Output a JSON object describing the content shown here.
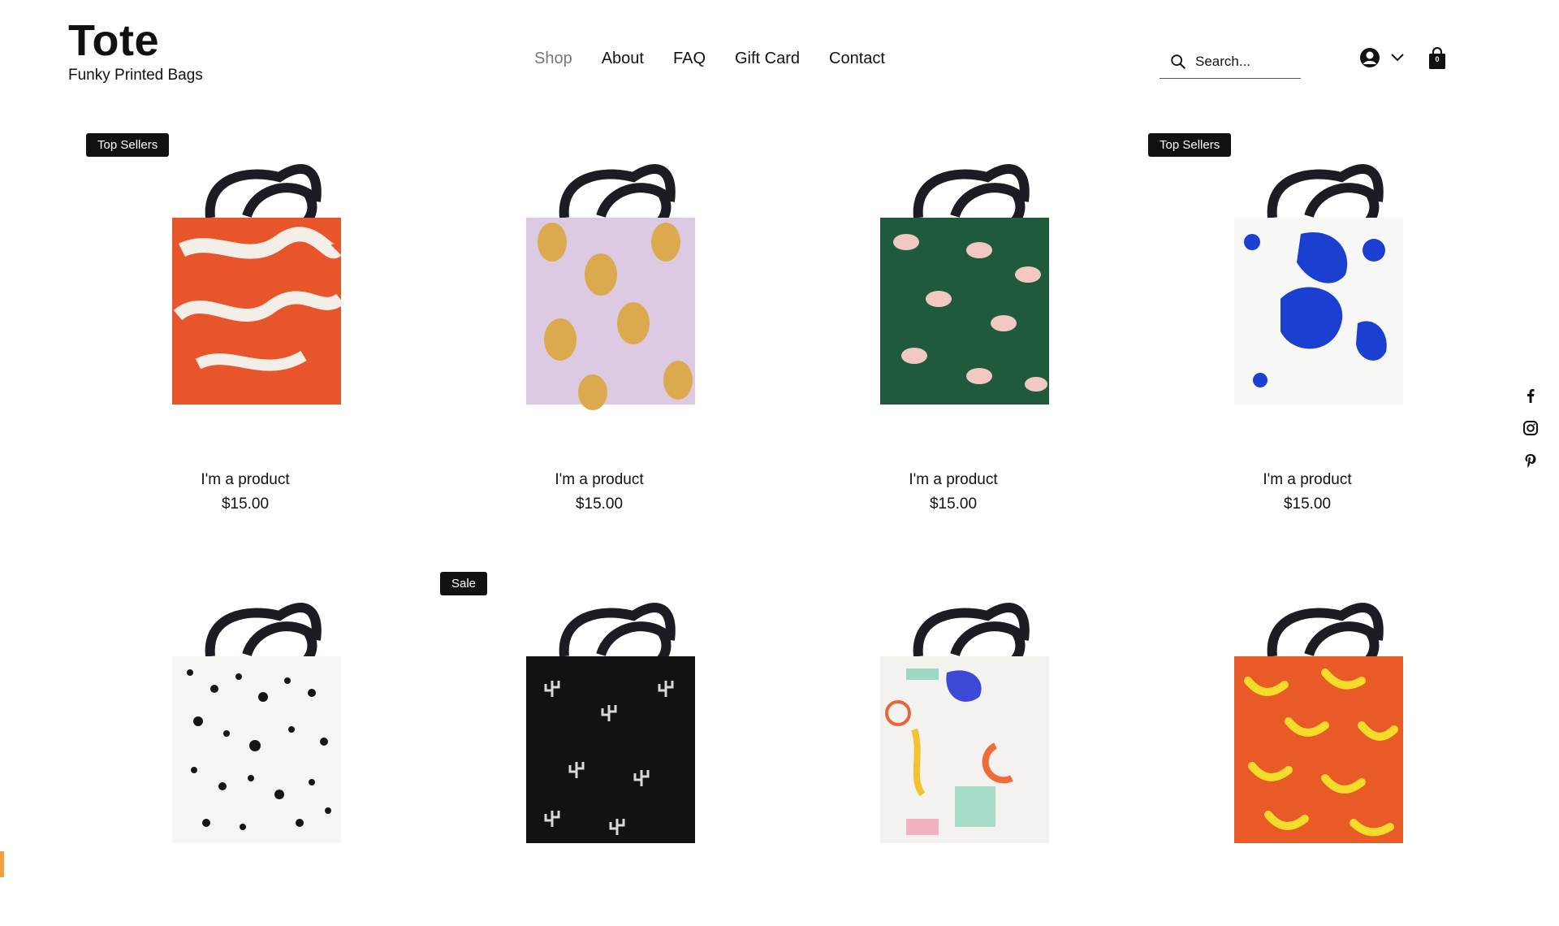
{
  "brand": {
    "title": "Tote",
    "subtitle": "Funky Printed Bags"
  },
  "nav": {
    "items": [
      {
        "label": "Shop",
        "active": true
      },
      {
        "label": "About",
        "active": false
      },
      {
        "label": "FAQ",
        "active": false
      },
      {
        "label": "Gift Card",
        "active": false
      },
      {
        "label": "Contact",
        "active": false
      }
    ]
  },
  "search": {
    "placeholder": "Search...",
    "icon": "search-icon"
  },
  "account": {
    "icon": "account-icon",
    "chevron": "chevron-down-icon"
  },
  "cart": {
    "icon": "bag-icon",
    "count": "0"
  },
  "products": [
    {
      "badge": "Top Sellers",
      "name": "I'm a product",
      "price": "$15.00",
      "pattern": "orange-swirls"
    },
    {
      "badge": "",
      "name": "I'm a product",
      "price": "$15.00",
      "pattern": "lavender-lemons"
    },
    {
      "badge": "",
      "name": "I'm a product",
      "price": "$15.00",
      "pattern": "green-hands"
    },
    {
      "badge": "Top Sellers",
      "name": "I'm a product",
      "price": "$15.00",
      "pattern": "blue-blobs"
    },
    {
      "badge": "",
      "name": "",
      "price": "",
      "pattern": "black-dots"
    },
    {
      "badge": "Sale",
      "name": "",
      "price": "",
      "pattern": "black-cactus"
    },
    {
      "badge": "",
      "name": "",
      "price": "",
      "pattern": "pastel-abstract"
    },
    {
      "badge": "",
      "name": "",
      "price": "",
      "pattern": "orange-bananas"
    }
  ],
  "social": [
    "facebook-icon",
    "instagram-icon",
    "pinterest-icon"
  ],
  "colors": {
    "text": "#111111",
    "active_nav": "#777777",
    "badge_bg": "#111111"
  }
}
